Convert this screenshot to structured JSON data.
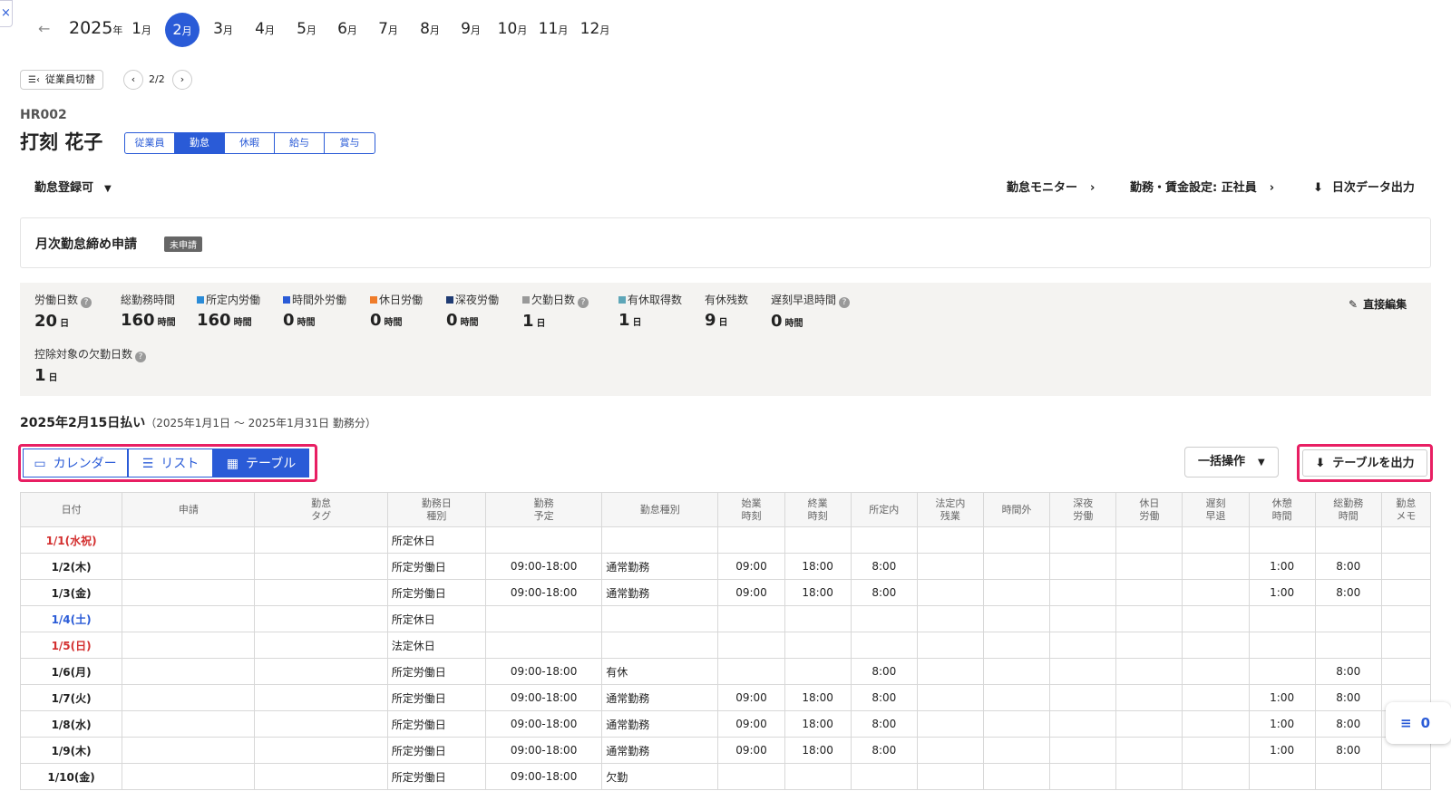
{
  "month_bar": {
    "year": "2025",
    "year_suffix": "年",
    "month_suffix": "月",
    "months": [
      "1",
      "2",
      "3",
      "4",
      "5",
      "6",
      "7",
      "8",
      "9",
      "10",
      "11",
      "12"
    ],
    "active_month": "2"
  },
  "employee_switch": {
    "label": "従業員切替",
    "pager": "2/2"
  },
  "employee": {
    "code": "HR002",
    "name": "打刻 花子"
  },
  "tabs": [
    "従業員",
    "勤怠",
    "休暇",
    "給与",
    "賞与"
  ],
  "actions": {
    "attendance_status": "勤怠登録可",
    "monitor": "勤怠モニター",
    "wage_setting": "勤務・賃金設定: 正社員",
    "daily_export": "日次データ出力"
  },
  "closing": {
    "title": "月次勤怠締め申請",
    "badge": "未申請"
  },
  "summary": {
    "direct_edit": "直接編集",
    "stats": [
      {
        "label": "労働日数",
        "value": "20",
        "unit": "日",
        "help": true
      },
      {
        "label": "総勤務時間",
        "value": "160",
        "unit": "時間"
      },
      {
        "label": "所定内労働",
        "value": "160",
        "unit": "時間",
        "color": "#2a8bd7"
      },
      {
        "label": "時間外労働",
        "value": "0",
        "unit": "時間",
        "color": "#2a5bd7"
      },
      {
        "label": "休日労働",
        "value": "0",
        "unit": "時間",
        "color": "#ef7c2a"
      },
      {
        "label": "深夜労働",
        "value": "0",
        "unit": "時間",
        "color": "#1f3b73"
      },
      {
        "label": "欠勤日数",
        "value": "1",
        "unit": "日",
        "color": "#999999",
        "help": true
      },
      {
        "label": "有休取得数",
        "value": "1",
        "unit": "日",
        "color": "#5ea6b8"
      },
      {
        "label": "有休残数",
        "value": "9",
        "unit": "日"
      },
      {
        "label": "遅刻早退時間",
        "value": "0",
        "unit": "時間",
        "help": true
      }
    ],
    "deduction": {
      "label": "控除対象の欠勤日数",
      "value": "1",
      "unit": "日"
    }
  },
  "payment": {
    "title": "2025年2月15日払い",
    "period": "（2025年1月1日 ～ 2025年1月31日 勤務分）"
  },
  "views": {
    "calendar": "カレンダー",
    "list": "リスト",
    "table": "テーブル"
  },
  "bulk_action": "一括操作",
  "export_table": "テーブルを出力",
  "table": {
    "headers": [
      "日付",
      "申請",
      "勤怠\nタグ",
      "勤務日\n種別",
      "勤務\n予定",
      "勤怠種別",
      "始業\n時刻",
      "終業\n時刻",
      "所定内",
      "法定内\n残業",
      "時間外",
      "深夜\n労働",
      "休日\n労働",
      "遅刻\n早退",
      "休憩\n時間",
      "総勤務\n時間",
      "勤怠\nメモ"
    ],
    "rows": [
      {
        "date": "1/1(水祝)",
        "date_color": "red",
        "day_type": "所定休日",
        "plan": "",
        "kind": "",
        "start": "",
        "end": "",
        "regular": "",
        "break": "",
        "total": ""
      },
      {
        "date": "1/2(木)",
        "date_color": "",
        "day_type": "所定労働日",
        "plan": "09:00-18:00",
        "kind": "通常勤務",
        "start": "09:00",
        "end": "18:00",
        "regular": "8:00",
        "break": "1:00",
        "total": "8:00"
      },
      {
        "date": "1/3(金)",
        "date_color": "",
        "day_type": "所定労働日",
        "plan": "09:00-18:00",
        "kind": "通常勤務",
        "start": "09:00",
        "end": "18:00",
        "regular": "8:00",
        "break": "1:00",
        "total": "8:00"
      },
      {
        "date": "1/4(土)",
        "date_color": "blue",
        "day_type": "所定休日",
        "plan": "",
        "kind": "",
        "start": "",
        "end": "",
        "regular": "",
        "break": "",
        "total": ""
      },
      {
        "date": "1/5(日)",
        "date_color": "red",
        "day_type": "法定休日",
        "plan": "",
        "kind": "",
        "start": "",
        "end": "",
        "regular": "",
        "break": "",
        "total": ""
      },
      {
        "date": "1/6(月)",
        "date_color": "",
        "day_type": "所定労働日",
        "plan": "09:00-18:00",
        "kind": "有休",
        "start": "",
        "end": "",
        "regular": "8:00",
        "break": "",
        "total": "8:00"
      },
      {
        "date": "1/7(火)",
        "date_color": "",
        "day_type": "所定労働日",
        "plan": "09:00-18:00",
        "kind": "通常勤務",
        "start": "09:00",
        "end": "18:00",
        "regular": "8:00",
        "break": "1:00",
        "total": "8:00"
      },
      {
        "date": "1/8(水)",
        "date_color": "",
        "day_type": "所定労働日",
        "plan": "09:00-18:00",
        "kind": "通常勤務",
        "start": "09:00",
        "end": "18:00",
        "regular": "8:00",
        "break": "1:00",
        "total": "8:00"
      },
      {
        "date": "1/9(木)",
        "date_color": "",
        "day_type": "所定労働日",
        "plan": "09:00-18:00",
        "kind": "通常勤務",
        "start": "09:00",
        "end": "18:00",
        "regular": "8:00",
        "break": "1:00",
        "total": "8:00"
      },
      {
        "date": "1/10(金)",
        "date_color": "",
        "day_type": "所定労働日",
        "plan": "09:00-18:00",
        "kind": "欠勤",
        "start": "",
        "end": "",
        "regular": "",
        "break": "",
        "total": ""
      }
    ]
  },
  "fab": {
    "count": "0"
  }
}
